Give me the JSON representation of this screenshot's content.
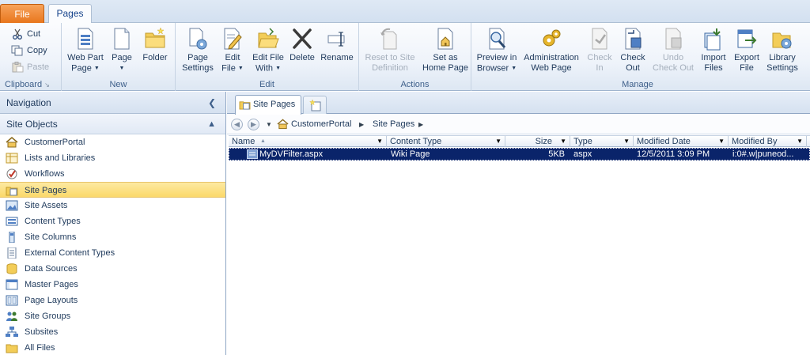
{
  "tabs": {
    "file": "File",
    "pages": "Pages"
  },
  "ribbon": {
    "clipboard": {
      "label": "Clipboard",
      "cut": "Cut",
      "copy": "Copy",
      "paste": "Paste"
    },
    "new": {
      "label": "New",
      "web_part_page_1": "Web Part",
      "web_part_page_2": "Page",
      "page": "Page",
      "folder": "Folder"
    },
    "edit": {
      "label": "Edit",
      "page_settings_1": "Page",
      "page_settings_2": "Settings",
      "edit_file_1": "Edit",
      "edit_file_2": "File",
      "edit_with_1": "Edit File",
      "edit_with_2": "With",
      "delete": "Delete",
      "rename": "Rename"
    },
    "actions": {
      "label": "Actions",
      "reset_1": "Reset to Site",
      "reset_2": "Definition",
      "set_home_1": "Set as",
      "set_home_2": "Home Page"
    },
    "manage": {
      "label": "Manage",
      "preview_1": "Preview in",
      "preview_2": "Browser",
      "admin_1": "Administration",
      "admin_2": "Web Page",
      "check_in_1": "Check",
      "check_in_2": "In",
      "check_out_1": "Check",
      "check_out_2": "Out",
      "undo_1": "Undo",
      "undo_2": "Check Out",
      "import_1": "Import",
      "import_2": "Files",
      "export_1": "Export",
      "export_2": "File",
      "library_1": "Library",
      "library_2": "Settings"
    }
  },
  "navigation": {
    "title": "Navigation",
    "section": "Site Objects",
    "items": [
      {
        "label": "CustomerPortal"
      },
      {
        "label": "Lists and Libraries"
      },
      {
        "label": "Workflows"
      },
      {
        "label": "Site Pages"
      },
      {
        "label": "Site Assets"
      },
      {
        "label": "Content Types"
      },
      {
        "label": "Site Columns"
      },
      {
        "label": "External Content Types"
      },
      {
        "label": "Data Sources"
      },
      {
        "label": "Master Pages"
      },
      {
        "label": "Page Layouts"
      },
      {
        "label": "Site Groups"
      },
      {
        "label": "Subsites"
      },
      {
        "label": "All Files"
      }
    ]
  },
  "content": {
    "tab_label": "Site Pages",
    "breadcrumb": [
      "CustomerPortal",
      "Site Pages"
    ],
    "columns": [
      "Name",
      "Content Type",
      "Size",
      "Type",
      "Modified Date",
      "Modified By"
    ],
    "rows": [
      {
        "name": "MyDVFilter.aspx",
        "content_type": "Wiki Page",
        "size": "5KB",
        "type": "aspx",
        "modified_date": "12/5/2011 3:09 PM",
        "modified_by": "i:0#.w|puneod..."
      }
    ]
  },
  "colors": {
    "file_tab": "#e8761d",
    "selection": "#0a246a",
    "nav_selected": "#fbd96a"
  }
}
